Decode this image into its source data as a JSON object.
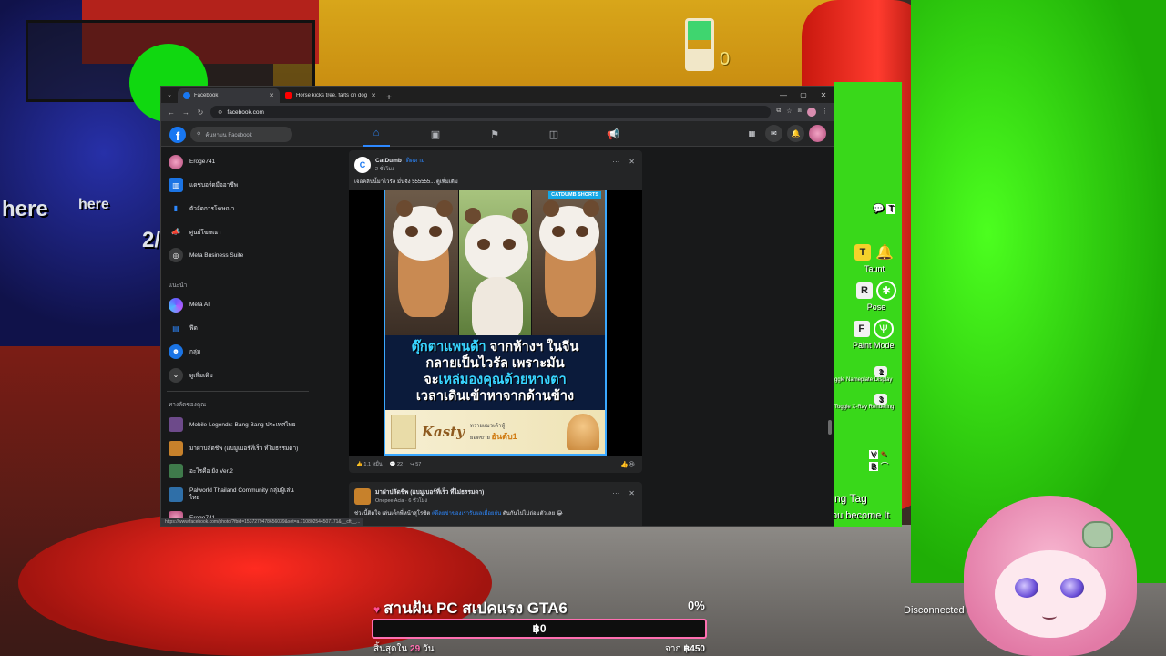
{
  "browser": {
    "tabs": [
      {
        "title": "Facebook",
        "active": true,
        "favicon_color": "#1877f2"
      },
      {
        "title": "Horse kicks tree, farts on dog",
        "active": false,
        "favicon_color": "#ff0000"
      }
    ],
    "url": "facebook.com",
    "status_url": "https://www.facebook.com/photo/?fbid=1537279478656039&set=a.710802544507171&__cft__..."
  },
  "facebook": {
    "search_placeholder": "ค้นหาบน Facebook",
    "left_menu": [
      {
        "label": "Eroge741",
        "icon": "profile-avatar-icon"
      },
      {
        "label": "แดชบอร์ดมืออาชีพ",
        "icon": "dashboard-icon"
      },
      {
        "label": "ตัวจัดการโฆษณา",
        "icon": "ads-manager-icon"
      },
      {
        "label": "ศูนย์โฆษณา",
        "icon": "megaphone-icon"
      },
      {
        "label": "Meta Business Suite",
        "icon": "business-suite-icon"
      }
    ],
    "suggested_heading": "แนะนำ",
    "suggested_menu": [
      {
        "label": "Meta AI",
        "icon": "meta-ai-icon"
      },
      {
        "label": "ฟีด",
        "icon": "feed-icon"
      },
      {
        "label": "กลุ่ม",
        "icon": "groups-icon"
      },
      {
        "label": "ดูเพิ่มเติม",
        "icon": "chevron-down-icon"
      }
    ],
    "shortcuts_heading": "ทางลัดของคุณ",
    "shortcuts": [
      {
        "label": "Mobile Legends: Bang Bang ประเทศไทย"
      },
      {
        "label": "มาฝาปลัดชีพ (แบมูเบอร์ที่เร็ว ที่ไม่ธรรมดา)"
      },
      {
        "label": "อะไรคือ ยัง Ver.2"
      },
      {
        "label": "Palworld Thailand Community กลุ่มผู้เล่นไทย"
      },
      {
        "label": "Eroge741"
      }
    ],
    "post1": {
      "author": "CatDumb",
      "follow": "ติดตาม",
      "time": "2 ชั่วโมง",
      "text": "เจอคลิปนี้มาไวรัล มั่นจัง 555555... ",
      "see_more": "ดูเพิ่มเติม",
      "badge": "CATDUMB SHORTS",
      "caption_line1_hl": "ตุ๊กตาแพนด้า",
      "caption_line1": " จากห้างฯ ในจีน",
      "caption_line2": "กลายเป็นไวรัล เพราะมัน",
      "caption_line3_pre": "จะ",
      "caption_line3_hl": "เหล่มองคุณด้วยหางตา",
      "caption_line4": "เวลาเดินเข้าหาจากด้านข้าง",
      "ad_brand": "Kasty",
      "ad_text_small": "ทรายแมวเต้าหู้",
      "ad_text_pre": "ยอดขาย",
      "ad_text_big": "อันดับ1",
      "likes": "1.1 หมื่น",
      "comments": "22",
      "shares": "57"
    },
    "post2": {
      "author": "มาฝาปลัดชีพ (แบมูเบอร์ที่เร็ว ที่ไม่ธรรมดา)",
      "sub": "Onepee Acia · 6 ชั่วโมง",
      "text_pre": "ช่วงนี้ติดใจ เล่นเด็กพี่หน้าสุโรซิต ",
      "hashtag": "#ดีลยข่าของเรารับผลเมื่อยกัน",
      "text_post": " ดันกันไปไม่ถ่อมตัวเลย 😂"
    }
  },
  "game": {
    "left_text_1": "here",
    "left_text_2": "here",
    "left_text_3": "2/",
    "timer_count": "0",
    "hud": [
      {
        "key": "T",
        "label": "Taunt"
      },
      {
        "key": "R",
        "label": "Pose"
      },
      {
        "key": "F",
        "label": "Paint Mode"
      }
    ],
    "hud_toggles": [
      {
        "key": "2",
        "label": "ggle Nameplate Display"
      },
      {
        "key": "3",
        "label": "Toggle X-Ray Rendering"
      }
    ],
    "tag_text": "ng Tag",
    "become_text": "ou become It"
  },
  "stream": {
    "goal_title": "สานฝัน PC สเปคแรง GTA6",
    "goal_percent": "0%",
    "goal_fraction": 0.0,
    "goal_amount": "฿0",
    "days_left_pre": "สิ้นสุดใน ",
    "days_left_num": "29",
    "days_left_post": " วัน",
    "goal_from_pre": "จาก ",
    "goal_target": "฿450",
    "disconnected": "Disconnected"
  }
}
